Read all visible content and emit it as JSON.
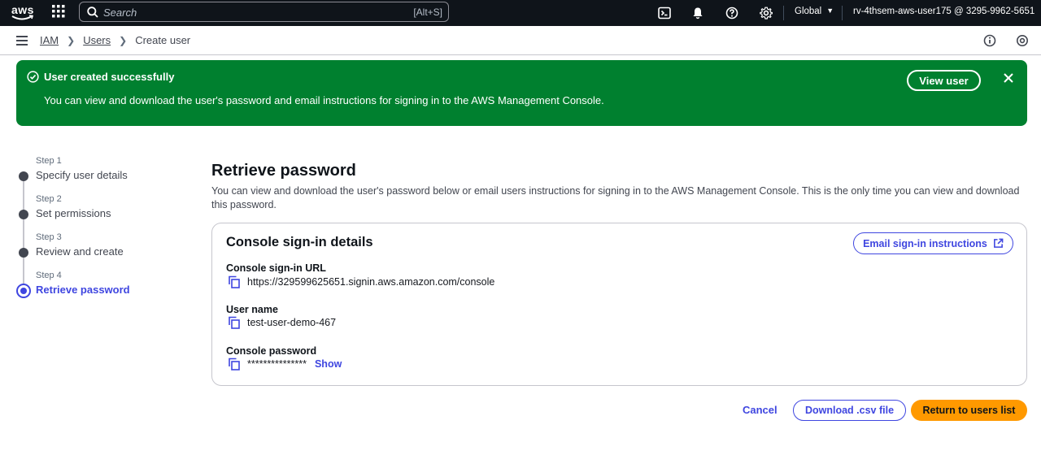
{
  "topnav": {
    "logo_text": "aws",
    "search": {
      "placeholder": "Search",
      "shortcut": "[Alt+S]"
    },
    "icons": [
      "cloudshell-icon",
      "bell-icon",
      "help-icon",
      "gear-icon"
    ],
    "region": "Global",
    "account": "rv-4thsem-aws-user175 @ 3295-9962-5651"
  },
  "breadcrumbs": {
    "items": [
      "IAM",
      "Users",
      "Create user"
    ]
  },
  "flash": {
    "title": "User created successfully",
    "message": "You can view and download the user's password and email instructions for signing in to the AWS Management Console.",
    "button": "View user",
    "color": "#00802f"
  },
  "steps": [
    {
      "label": "Step 1",
      "name": "Specify user details"
    },
    {
      "label": "Step 2",
      "name": "Set permissions"
    },
    {
      "label": "Step 3",
      "name": "Review and create"
    },
    {
      "label": "Step 4",
      "name": "Retrieve password",
      "active": true
    }
  ],
  "page": {
    "title": "Retrieve password",
    "description": "You can view and download the user's password below or email users instructions for signing in to the AWS Management Console. This is the only time you can view and download this password."
  },
  "card": {
    "title": "Console sign-in details",
    "email_button": "Email sign-in instructions",
    "url_label": "Console sign-in URL",
    "url_value": "https://329599625651.signin.aws.amazon.com/console",
    "username_label": "User name",
    "username_value": "test-user-demo-467",
    "password_label": "Console password",
    "password_value": "***************",
    "show_link": "Show"
  },
  "actions": {
    "cancel": "Cancel",
    "download": "Download .csv file",
    "return": "Return to users list"
  },
  "colors": {
    "accent": "#3f46e0",
    "primary_button": "#ff9900",
    "topnav_bg": "#0f141a"
  }
}
